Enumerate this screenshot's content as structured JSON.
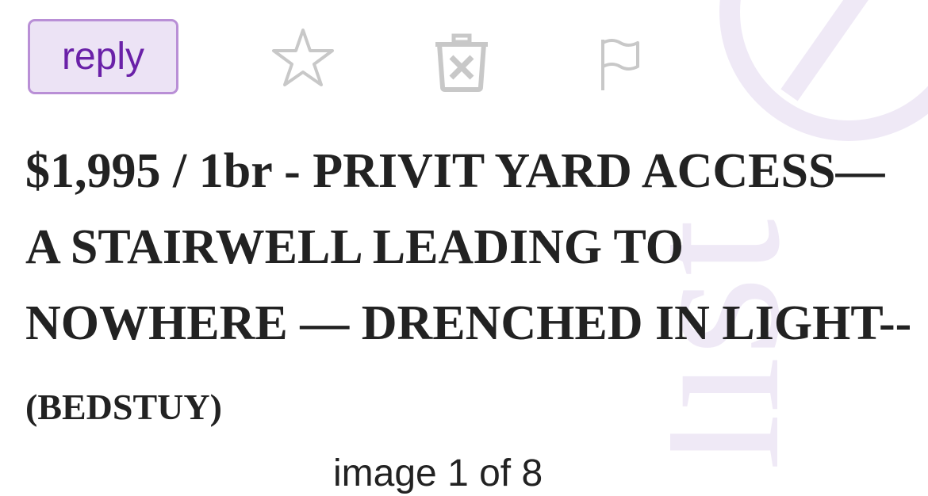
{
  "toolbar": {
    "reply_label": "reply",
    "icons": [
      "star-icon",
      "hide-icon",
      "flag-icon"
    ],
    "reply_border_color": "#b98fd6",
    "reply_bg_color": "#ece3f5",
    "reply_text_color": "#6a21a8",
    "icon_color": "#c8c8c8"
  },
  "posting": {
    "title": "$1,995 / 1br - PRIVIT YARD ACCESS—A STAIRWELL LEADING TO NOWHERE — DRENCHED IN LIGHT--",
    "hood": " (BEDSTUY)"
  },
  "gallery": {
    "counter": "image 1 of 8"
  },
  "watermark": {
    "text": "list",
    "color": "#efe9f6"
  }
}
